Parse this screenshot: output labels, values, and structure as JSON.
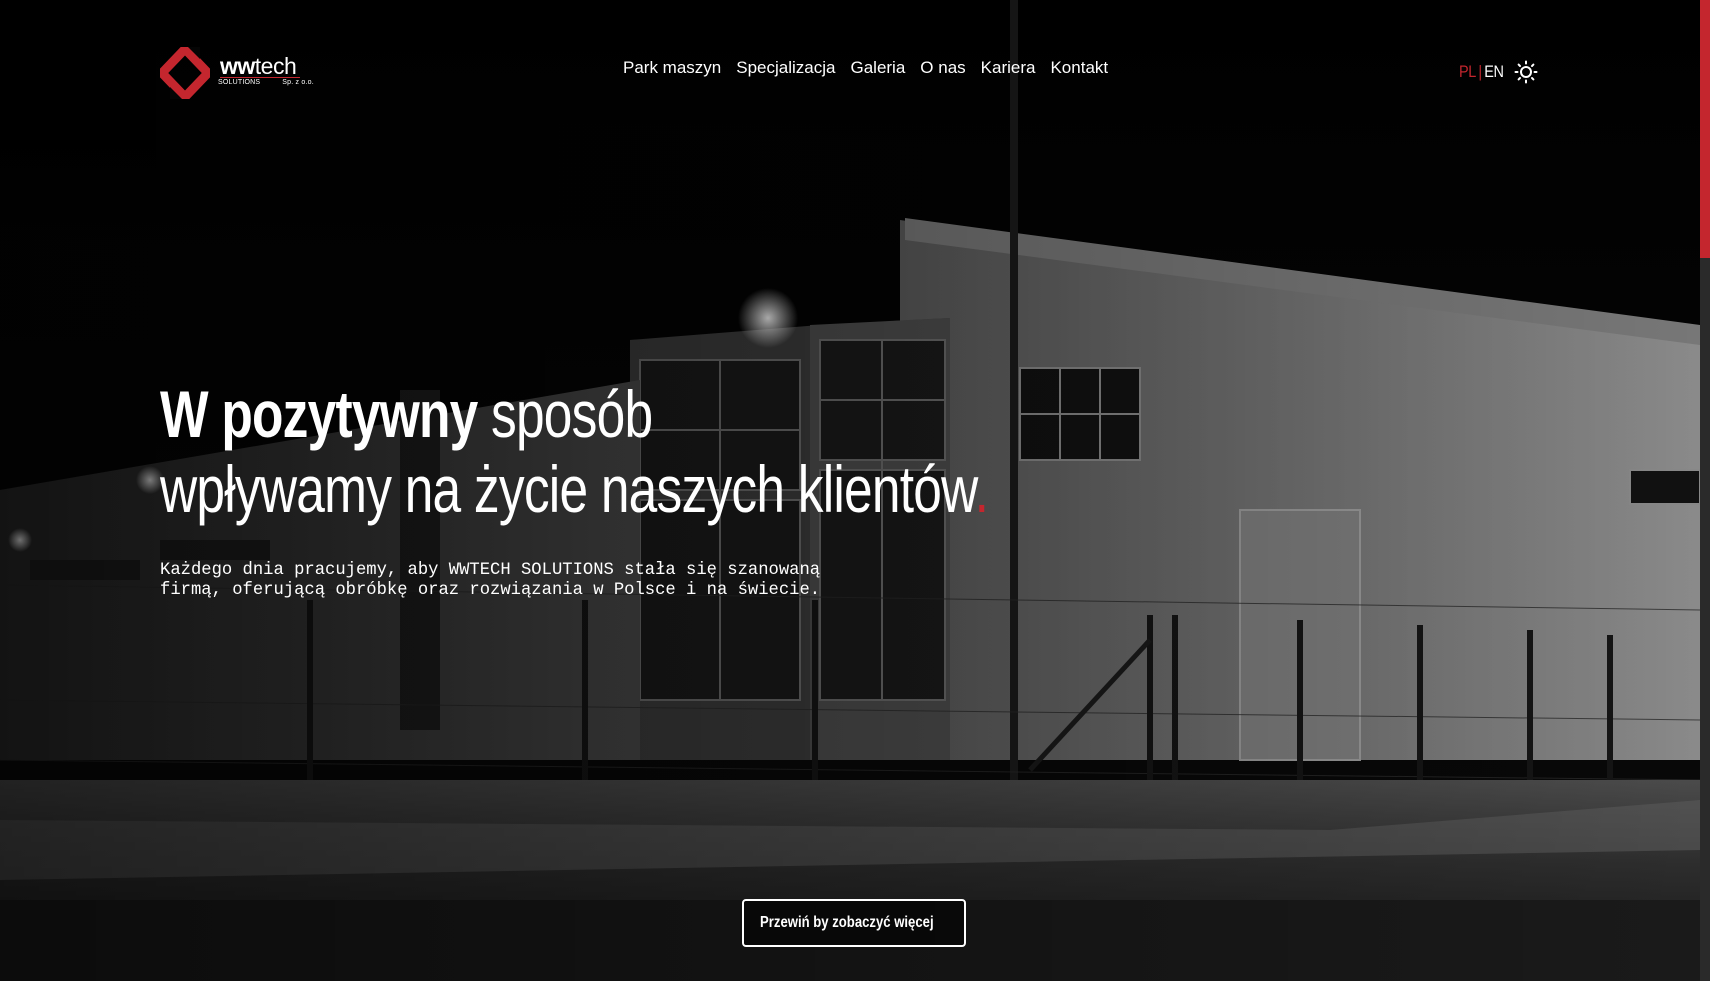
{
  "header": {
    "logo": {
      "word_bold": "ww",
      "word_light": "tech",
      "sub_left": "SOLUTIONS",
      "sub_right": "Sp. z o.o."
    },
    "nav": [
      {
        "label": "Park maszyn"
      },
      {
        "label": "Specjalizacja"
      },
      {
        "label": "Galeria"
      },
      {
        "label": "O nas"
      },
      {
        "label": "Kariera"
      },
      {
        "label": "Kontakt"
      }
    ],
    "lang": {
      "pl": "PL",
      "separator": "|",
      "en": "EN",
      "active": "PL"
    },
    "theme_toggle_icon": "sun-icon"
  },
  "hero": {
    "headline_bold": "W pozytywny",
    "headline_rest": " sposób",
    "headline_line2": "wpływamy na życie naszych klientów",
    "headline_dot": ".",
    "lead": "Każdego dnia pracujemy, aby WWTECH SOLUTIONS stała się szanowaną firmą, oferującą obróbkę oraz rozwiązania w Polsce i na świecie.",
    "scroll_button": "Przewiń by zobaczyć więcej",
    "scroll_icon": "chevron-up-down-icon"
  },
  "colors": {
    "accent": "#c4262e",
    "background": "#050505",
    "text": "#ffffff"
  }
}
